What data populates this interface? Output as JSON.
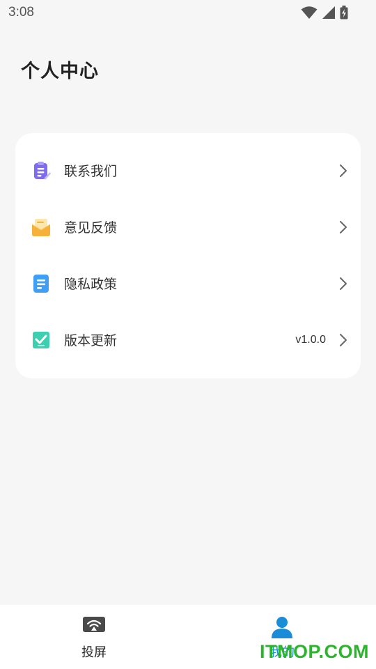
{
  "status_bar": {
    "time": "3:08"
  },
  "header": {
    "title": "个人中心"
  },
  "menu": {
    "items": [
      {
        "label": "联系我们",
        "icon": "clipboard-icon",
        "value": ""
      },
      {
        "label": "意见反馈",
        "icon": "mail-icon",
        "value": ""
      },
      {
        "label": "隐私政策",
        "icon": "document-icon",
        "value": ""
      },
      {
        "label": "版本更新",
        "icon": "check-icon",
        "value": "v1.0.0"
      }
    ]
  },
  "bottom_nav": {
    "tabs": [
      {
        "label": "投屏",
        "icon": "screen-cast-icon",
        "active": false
      },
      {
        "label": "我的",
        "icon": "user-icon",
        "active": true
      }
    ]
  },
  "watermark": {
    "text": "ITMOP.COM"
  },
  "colors": {
    "background": "#f6f6f6",
    "active_tab": "#1a8cd8",
    "watermark": "#2cb52c"
  }
}
